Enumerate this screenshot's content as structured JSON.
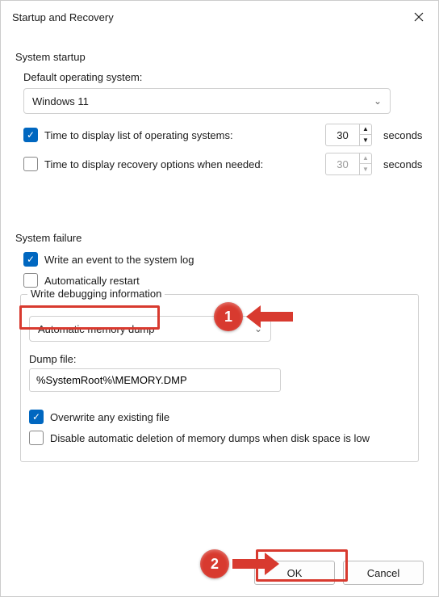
{
  "titlebar": {
    "title": "Startup and Recovery"
  },
  "startup": {
    "section_label": "System startup",
    "default_os_label": "Default operating system:",
    "default_os_value": "Windows 11",
    "display_list_label": "Time to display list of operating systems:",
    "display_list_checked": true,
    "display_list_seconds": "30",
    "display_recovery_label": "Time to display recovery options when needed:",
    "display_recovery_checked": false,
    "display_recovery_seconds": "30",
    "seconds_label": "seconds"
  },
  "failure": {
    "section_label": "System failure",
    "write_event_label": "Write an event to the system log",
    "write_event_checked": true,
    "auto_restart_label": "Automatically restart",
    "auto_restart_checked": false,
    "debug_group_label": "Write debugging information",
    "debug_type_value": "Automatic memory dump",
    "dump_file_label": "Dump file:",
    "dump_file_value": "%SystemRoot%\\MEMORY.DMP",
    "overwrite_label": "Overwrite any existing file",
    "overwrite_checked": true,
    "disable_delete_label": "Disable automatic deletion of memory dumps when disk space is low",
    "disable_delete_checked": false
  },
  "buttons": {
    "ok": "OK",
    "cancel": "Cancel"
  },
  "annotations": {
    "one": "1",
    "two": "2"
  }
}
